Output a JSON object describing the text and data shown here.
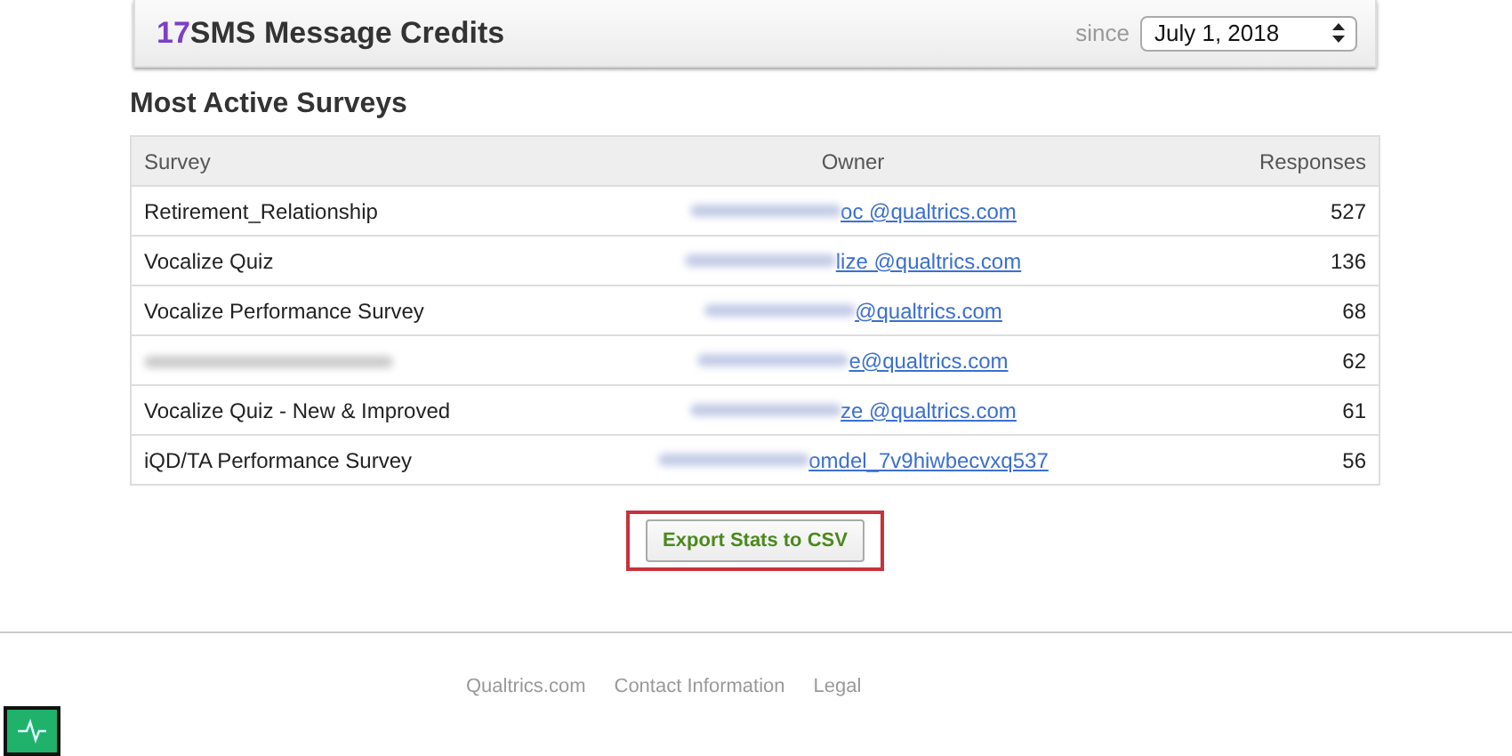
{
  "credits_bar": {
    "count": "17",
    "title": "SMS Message Credits",
    "since_label": "since",
    "since_value": "July 1, 2018"
  },
  "section_title": "Most Active Surveys",
  "table": {
    "columns": [
      "Survey",
      "Owner",
      "Responses"
    ],
    "rows": [
      {
        "survey": "Retirement_Relationship",
        "owner": "oc @qualtrics.com",
        "responses": "527"
      },
      {
        "survey": "Vocalize Quiz",
        "owner": "lize @qualtrics.com",
        "responses": "136"
      },
      {
        "survey": "Vocalize Performance Survey",
        "owner": "@qualtrics.com",
        "responses": "68"
      },
      {
        "survey_redacted": true,
        "owner": "e@qualtrics.com",
        "responses": "62"
      },
      {
        "survey": "Vocalize Quiz - New & Improved",
        "owner": "ze @qualtrics.com",
        "responses": "61"
      },
      {
        "survey": "iQD/TA Performance Survey",
        "owner": "omdel_7v9hiwbecvxq537",
        "responses": "56"
      }
    ]
  },
  "export_button": {
    "label": "Export Stats to CSV",
    "highlighted": true
  },
  "footer_links": [
    "Qualtrics.com",
    "Contact Information",
    "Legal"
  ]
}
